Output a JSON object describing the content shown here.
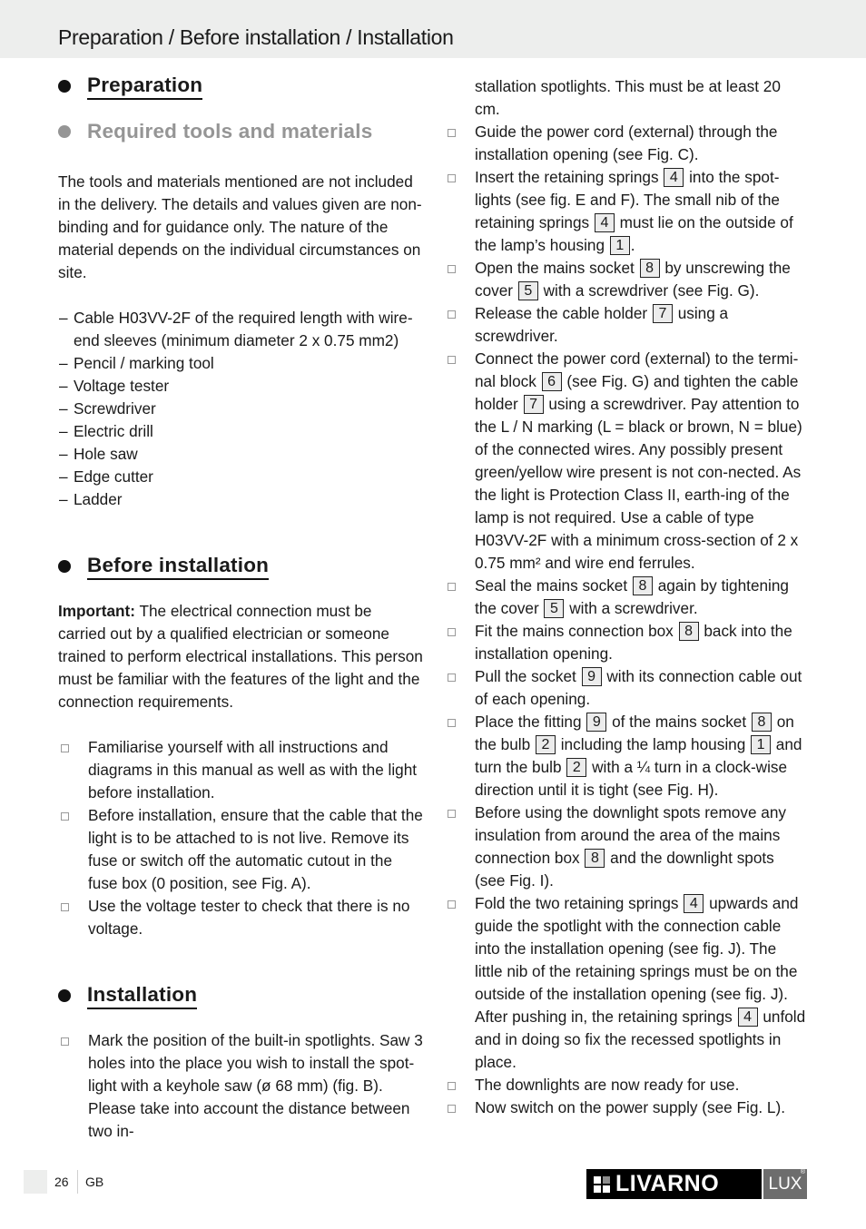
{
  "header": {
    "title": "Preparation / Before installation / Installation"
  },
  "preparation": {
    "heading": "Preparation",
    "subheading": "Required tools and materials",
    "intro": "The tools and materials mentioned are not included in the delivery. The details and values given are non-binding and for guidance only. The nature of the material depends on the individual circumstances on site.",
    "tools": [
      "Cable H03VV-2F of the required length with wire-end sleeves (minimum diameter 2 x 0.75 mm2)",
      "Pencil / marking tool",
      "Voltage tester",
      "Screwdriver",
      "Electric drill",
      "Hole saw",
      "Edge cutter",
      "Ladder"
    ],
    "dash": "–"
  },
  "before_installation": {
    "heading": "Before installation",
    "important_label": "Important:",
    "important_text": " The electrical connection must be carried out by a qualified electrician or someone trained to perform electrical installations. This person must be familiar with the features of the light and the connection requirements.",
    "steps": [
      "Familiarise yourself with all instructions and diagrams in this manual as well as with the light before installation.",
      "Before installation, ensure that the cable that the light is to be attached to is not live. Remove its fuse or switch off the automatic cutout in the fuse box (0 position, see Fig. A).",
      "Use the voltage tester to check that there is no voltage."
    ]
  },
  "installation": {
    "heading": "Installation",
    "step1": "Mark the position of the built-in spotlights. Saw 3 holes into the place you wish to install the spot-light with a keyhole saw (ø 68 mm) (fig. B). Please take into account the distance between two in-",
    "step1_cont": "stallation spotlights. This must be at least 20 cm.",
    "step2": "Guide the power cord (external) through the installation opening (see Fig. C).",
    "step3": {
      "a": "Insert the retaining springs ",
      "r1": "4",
      "b": " into the spot-lights (see fig. E and F). The small nib of the retaining springs ",
      "r2": "4",
      "c": " must lie on the outside of the lamp’s housing ",
      "r3": "1",
      "d": "."
    },
    "step4": {
      "a": "Open the mains socket ",
      "r1": "8",
      "b": " by unscrewing the cover ",
      "r2": "5",
      "c": " with a screwdriver (see Fig. G)."
    },
    "step5": {
      "a": "Release the cable holder ",
      "r1": "7",
      "b": " using a screwdriver."
    },
    "step6": {
      "a": "Connect the power cord (external) to the termi-nal block ",
      "r1": "6",
      "b": " (see Fig. G) and tighten the cable holder ",
      "r2": "7",
      "c": " using a screwdriver. Pay attention to the L / N marking (L = black or brown, N = blue) of the connected wires. Any possibly present green/yellow wire present is not con-nected. As the light is Protection Class II, earth-ing of the lamp is not required. Use a cable of type H03VV-2F with a minimum cross-section of 2 x 0.75 mm² and wire end ferrules."
    },
    "step7": {
      "a": "Seal the mains socket ",
      "r1": "8",
      "b": " again by tightening the cover ",
      "r2": "5",
      "c": " with a screwdriver."
    },
    "step8": {
      "a": "Fit the mains connection box ",
      "r1": "8",
      "b": " back into the installation opening."
    },
    "step9": {
      "a": "Pull the socket ",
      "r1": "9",
      "b": " with its connection cable out of each opening."
    },
    "step10": {
      "a": "Place the fitting ",
      "r1": "9",
      "b": " of the mains socket ",
      "r2": "8",
      "c": " on the bulb ",
      "r3": "2",
      "d": " including the lamp housing ",
      "r4": "1",
      "e": " and turn the bulb ",
      "r5": "2",
      "f": " with a ¼ turn in a clock-wise direction until it is tight (see Fig. H)."
    },
    "step11": {
      "a": "Before using the downlight spots remove any insulation from around the area of the mains connection box ",
      "r1": "8",
      "b": " and the downlight spots (see Fig. I)."
    },
    "step12": {
      "a": "Fold the two retaining springs ",
      "r1": "4",
      "b": " upwards and guide the spotlight with the connection cable into the installation opening (see fig. J). The little nib of the retaining springs must be on the outside of the installation opening (see fig. J). After pushing in, the retaining springs ",
      "r2": "4",
      "c": " unfold and in doing so fix the recessed spotlights in place."
    },
    "step13": "The downlights are now ready for use.",
    "step14": "Now switch on the power supply (see Fig. L)."
  },
  "footer": {
    "page_number": "26",
    "language": "GB",
    "brand": "LIVARNO",
    "brand_suffix": "LUX",
    "registered": "®"
  }
}
